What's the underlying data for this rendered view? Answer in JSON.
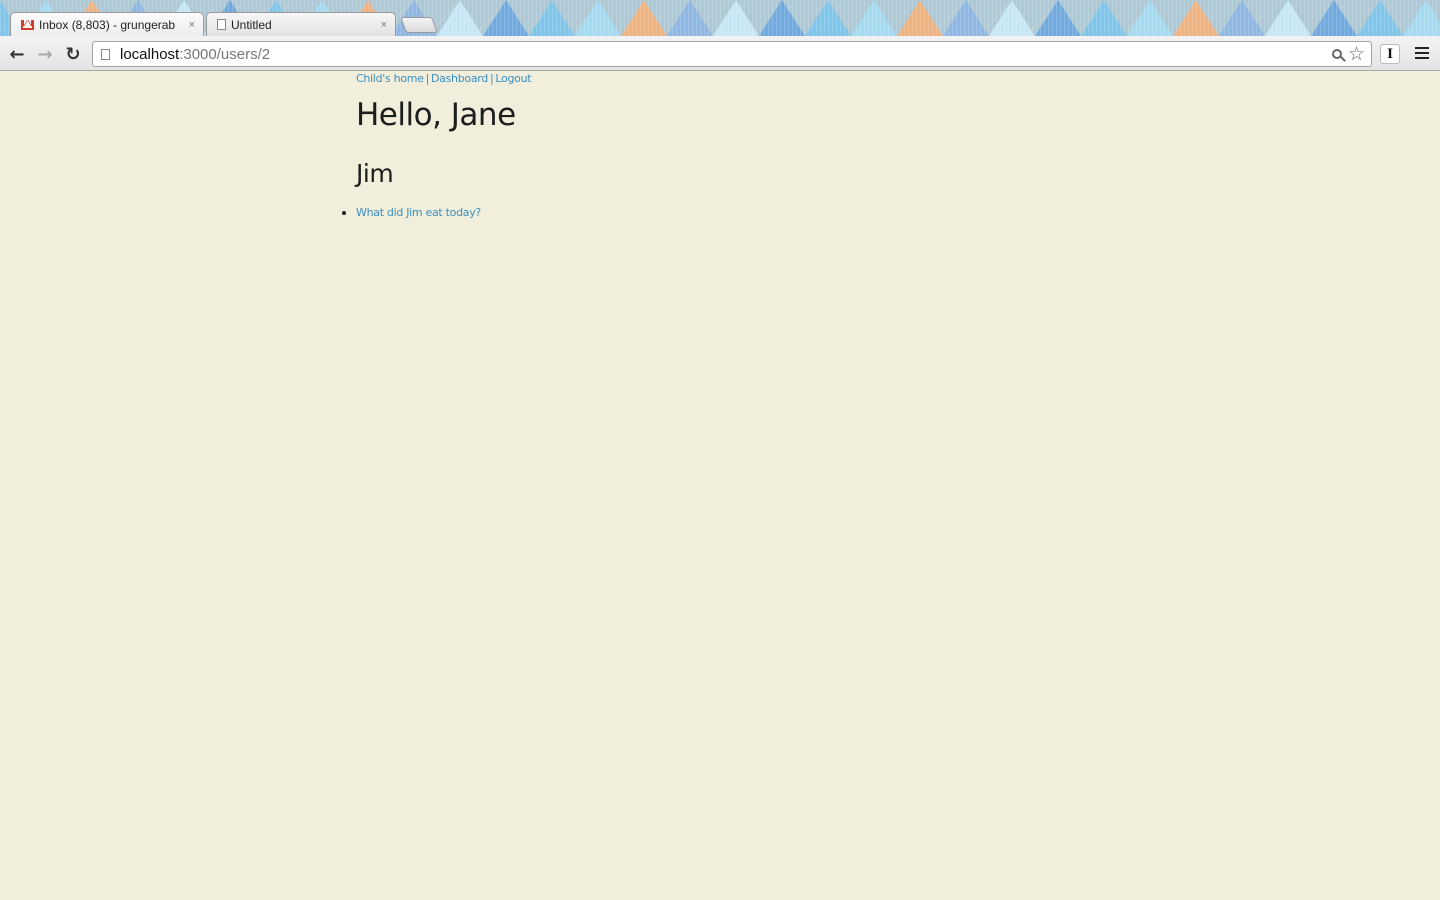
{
  "browser": {
    "tabs": [
      {
        "title": "Inbox (8,803) - grungerab",
        "icon": "gmail-icon",
        "active": true
      },
      {
        "title": "Untitled",
        "icon": "page-icon",
        "active": false
      }
    ],
    "tab_close_glyph": "×",
    "address": {
      "host": "localhost",
      "path": ":3000/users/2"
    },
    "extension_label": "I"
  },
  "nav": {
    "links": [
      "Child's home",
      "Dashboard",
      "Logout"
    ],
    "separator": "|"
  },
  "page": {
    "greeting": "Hello, Jane",
    "child_name": "Jim",
    "questions": [
      "What did Jim eat today?"
    ]
  },
  "colors": {
    "page_background": "#f1eedb",
    "link": "#3b8fc0",
    "text": "#1d1d1d"
  }
}
